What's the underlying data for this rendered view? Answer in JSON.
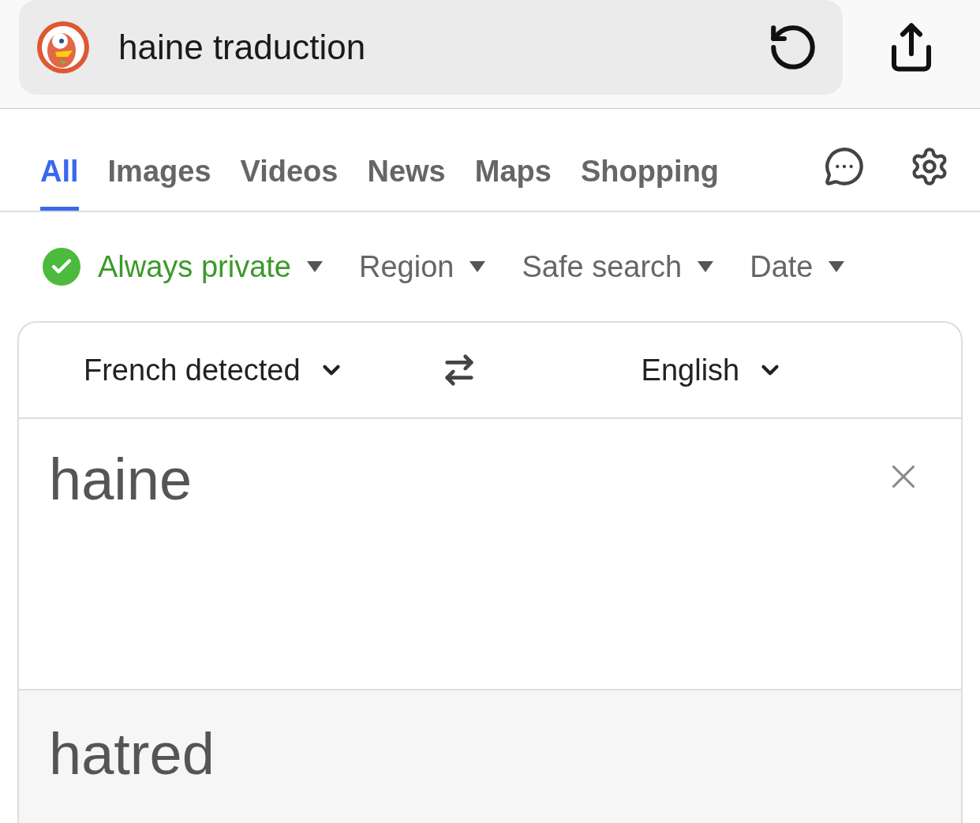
{
  "address_bar": {
    "query": "haine traduction"
  },
  "tabs": [
    {
      "label": "All",
      "selected": true
    },
    {
      "label": "Images",
      "selected": false
    },
    {
      "label": "Videos",
      "selected": false
    },
    {
      "label": "News",
      "selected": false
    },
    {
      "label": "Maps",
      "selected": false
    },
    {
      "label": "Shopping",
      "selected": false
    }
  ],
  "filters": [
    {
      "label": "Always private",
      "kind": "privacy"
    },
    {
      "label": "Region",
      "kind": "plain"
    },
    {
      "label": "Safe search",
      "kind": "plain"
    },
    {
      "label": "Date",
      "kind": "plain"
    }
  ],
  "translator": {
    "source_language": "French detected",
    "target_language": "English",
    "input": "haine",
    "output": "hatred"
  }
}
